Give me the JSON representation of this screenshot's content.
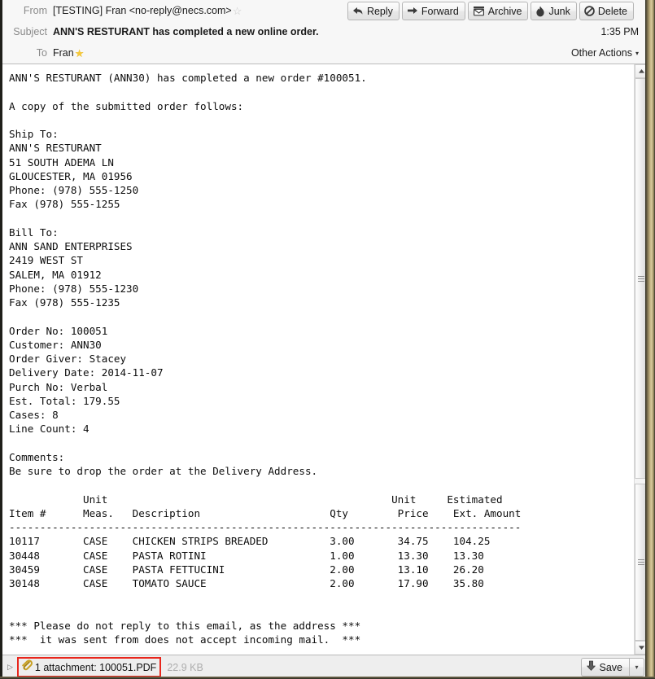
{
  "header": {
    "from_label": "From",
    "from_value": "[TESTING] Fran <no-reply@necs.com>",
    "subject_label": "Subject",
    "subject_value": "ANN'S RESTURANT has completed a new online order.",
    "to_label": "To",
    "to_value": "Fran",
    "time": "1:35 PM",
    "other_actions": "Other Actions",
    "other_actions_caret": "▾"
  },
  "toolbar": {
    "reply": "Reply",
    "forward": "Forward",
    "archive": "Archive",
    "junk": "Junk",
    "delete": "Delete"
  },
  "message": {
    "text": "ANN'S RESTURANT (ANN30) has completed a new order #100051.\n\nA copy of the submitted order follows:\n\nShip To:\nANN'S RESTURANT\n51 SOUTH ADEMA LN\nGLOUCESTER, MA 01956\nPhone: (978) 555-1250\nFax (978) 555-1255\n\nBill To:\nANN SAND ENTERPRISES\n2419 WEST ST\nSALEM, MA 01912\nPhone: (978) 555-1230\nFax (978) 555-1235\n\nOrder No: 100051\nCustomer: ANN30\nOrder Giver: Stacey\nDelivery Date: 2014-11-07\nPurch No: Verbal\nEst. Total: 179.55\nCases: 8\nLine Count: 4\n\nComments:\nBe sure to drop the order at the Delivery Address.\n\n            Unit                                              Unit     Estimated\nItem #      Meas.   Description                     Qty        Price    Ext. Amount\n-----------------------------------------------------------------------------------\n10117       CASE    CHICKEN STRIPS BREADED          3.00       34.75    104.25\n30448       CASE    PASTA ROTINI                    1.00       13.30    13.30\n30459       CASE    PASTA FETTUCINI                 2.00       13.10    26.20\n30148       CASE    TOMATO SAUCE                    2.00       17.90    35.80\n\n\n*** Please do not reply to this email, as the address ***\n***  it was sent from does not accept incoming mail.  ***",
    "order_summary": {
      "company": "ANN'S RESTURANT",
      "customer_code": "ANN30",
      "order_number": "100051",
      "order_giver": "Stacey",
      "delivery_date": "2014-11-07",
      "purch_no": "Verbal",
      "est_total": "179.55",
      "cases": "8",
      "line_count": "4",
      "comments": "Be sure to drop the order at the Delivery Address."
    },
    "ship_to": {
      "name": "ANN'S RESTURANT",
      "street": "51 SOUTH ADEMA LN",
      "city_state_zip": "GLOUCESTER, MA 01956",
      "phone": "Phone: (978) 555-1250",
      "fax": "Fax (978) 555-1255"
    },
    "bill_to": {
      "name": "ANN SAND ENTERPRISES",
      "street": "2419 WEST ST",
      "city_state_zip": "SALEM, MA 01912",
      "phone": "Phone: (978) 555-1230",
      "fax": "Fax (978) 555-1235"
    },
    "line_items_columns": [
      "Item #",
      "Unit Meas.",
      "Description",
      "Qty",
      "Unit Price",
      "Estimated Ext. Amount"
    ],
    "line_items": [
      [
        "10117",
        "CASE",
        "CHICKEN STRIPS BREADED",
        "3.00",
        "34.75",
        "104.25"
      ],
      [
        "30448",
        "CASE",
        "PASTA ROTINI",
        "1.00",
        "13.30",
        "13.30"
      ],
      [
        "30459",
        "CASE",
        "PASTA FETTUCINI",
        "2.00",
        "13.10",
        "26.20"
      ],
      [
        "30148",
        "CASE",
        "TOMATO SAUCE",
        "2.00",
        "17.90",
        "35.80"
      ]
    ],
    "footer_notice": [
      "*** Please do not reply to this email, as the address ***",
      "***  it was sent from does not accept incoming mail.  ***"
    ]
  },
  "attachment": {
    "expander": "▷",
    "label": "1 attachment: 100051.PDF",
    "size": "22.9 KB",
    "save_label": "Save",
    "save_caret": "▾"
  },
  "colors": {
    "highlight_red": "#e8261c",
    "star_gold": "#f5c93c",
    "paperclip_gold": "#c9a227",
    "header_bg": "#f7f7f7",
    "attach_bg": "#eeeeee"
  }
}
